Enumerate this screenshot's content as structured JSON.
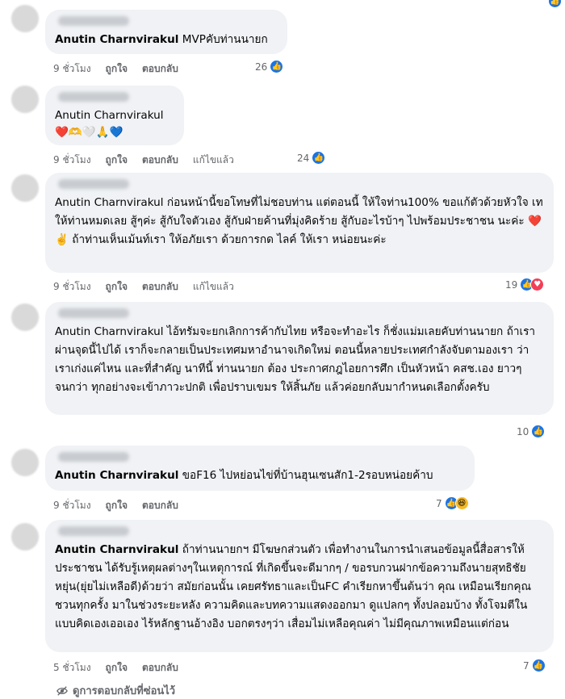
{
  "meta_labels": {
    "like": "ถูกใจ",
    "reply": "ตอบกลับ",
    "edited": "แก้ไขแล้ว"
  },
  "comments": [
    {
      "name": "Anutin Charnvirakul",
      "text": " MVPคับท่านนายก",
      "time": "9 ชั่วโมง",
      "count": "26",
      "edited": false
    },
    {
      "name": "Anutin Charnvirakul",
      "text": "❤️🫶🤍🙏💙",
      "time": "9 ชั่วโมง",
      "count": "24",
      "edited": true
    },
    {
      "name": "Anutin Charnvirakul",
      "text": " ก่อนหน้านี้ขอโทษที่ไม่ชอบท่าน แต่ตอนนี้ ให้ใจท่าน100% ขอแก้ตัวด้วยหัวใจ เท ให้ท่านหมดเลย สู้ๆค่ะ สู้กับใจตัวเอง สู้กับฝ่ายค้านที่มุ่งคิดร้าย สู้กับอะไรบ้าๆ ไปพร้อมประชาชน นะค่ะ ❤️ ✌️ ถ้าท่านเห็นเม้นท์เรา ให้อภัยเรา ด้วยการกด ไลค์ ให้เรา หน่อยนะค่ะ",
      "time": "9 ชั่วโมง",
      "count": "19",
      "edited": true
    },
    {
      "name": "Anutin Charnvirakul",
      "text": " ไอ้ทรัมจะยกเลิกการค้ากับไทย หรือจะทำอะไร ก็ชั่งแม่มเลยคับท่านนายก ถ้าเราผ่านจุดนี้ไปได้ เราก็จะกลายเป็นประเทศมหาอำนาจเกิดใหม่ ตอนนี้หลายประเทศกำลังจับตามองเรา ว่าเราเก่งแค่ไหน และที่สำคัญ นาทีนี้ ท่านนายก ต้อง ประกาศกฎไอยการศึก เป็นหัวหน้า คสช.เอง ยาวๆ จนกว่า ทุกอย่างจะเข้าภาวะปกติ เพื่อปราบเขมร ให้สิ้นภัย แล้วค่อยกลับมากำหนดเลือกตั้งครับ",
      "time": "",
      "count": "10",
      "edited": false
    },
    {
      "name": "Anutin Charnvirakul",
      "text": " ขอF16 ไปหย่อนไข่ที่บ้านฮุนเซนสัก1-2รอบหน่อยค้าบ",
      "time": "9 ชั่วโมง",
      "count": "7",
      "edited": false
    },
    {
      "name": "Anutin Charnvirakul",
      "text": " ถ้าท่านนายกฯ มีโฆษกส่วนตัว เพื่อทำงานในการนำเสนอข้อมูลนี้สื่อสารให้ประชาชน ได้รับรู้เหตุผลต่างๆในเหตุการณ์ ที่เกิดขึ้นจะดีมากๆ / ขอรบกวนฝากข้อความถึงนายสุทธิชัย หยุ่น(ยุ่ยไม่เหลือดี)ด้วยว่า สมัยก่อนนั้น เคยศรัทธาและเป็นFC คำเรียกหาขึ้นต้นว่า คุณ เหมือนเรียกคุณชวนทุกครั้ง มาในช่วงระยะหลัง ความคิดและบทความแสดงออกมา ดูแปลกๆ ทั้งปลอมบ้าง ทั้งโจมตีในแบบคิดเองเออเอง ไร้หลักฐานอ้างอิง บอกตรงๆว่า เสื่อมไม่เหลือคุณค่า ไม่มีคุณภาพเหมือนแต่ก่อน",
      "time": "5 ชั่วโมง",
      "count": "7",
      "edited": false
    }
  ],
  "hidden_replies": "ดูการตอบกลับที่ซ่อนไว้"
}
